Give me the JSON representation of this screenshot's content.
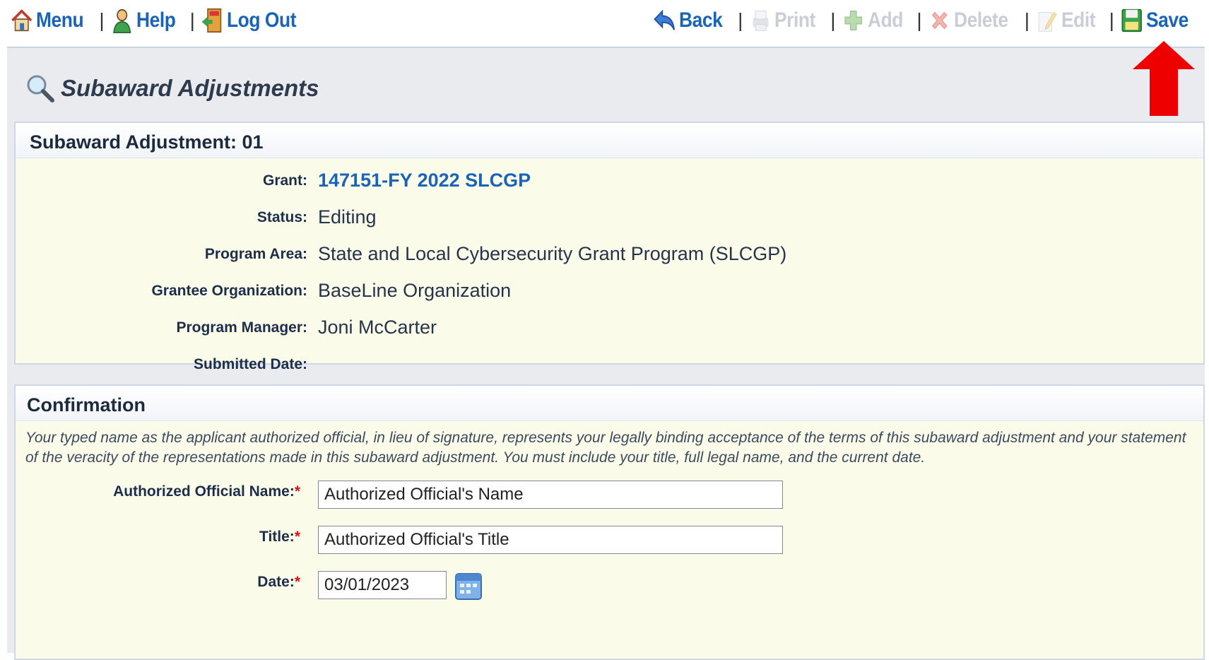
{
  "toolbar": {
    "left": [
      {
        "label": "Menu",
        "icon": "home-icon"
      },
      {
        "label": "Help",
        "icon": "help-person-icon"
      },
      {
        "label": "Log Out",
        "icon": "exit-door-icon"
      }
    ],
    "right": [
      {
        "label": "Back",
        "icon": "back-arrow-icon",
        "enabled": true
      },
      {
        "label": "Print",
        "icon": "printer-icon",
        "enabled": false
      },
      {
        "label": "Add",
        "icon": "add-icon",
        "enabled": false
      },
      {
        "label": "Delete",
        "icon": "delete-icon",
        "enabled": false
      },
      {
        "label": "Edit",
        "icon": "edit-icon",
        "enabled": false
      },
      {
        "label": "Save",
        "icon": "save-disk-icon",
        "enabled": true
      }
    ],
    "separator": "|"
  },
  "page": {
    "title": "Subaward Adjustments"
  },
  "details": {
    "header": "Subaward Adjustment: 01",
    "grant_label": "Grant:",
    "grant_value": "147151-FY 2022 SLCGP",
    "status_label": "Status:",
    "status_value": "Editing",
    "program_area_label": "Program Area:",
    "program_area_value": "State and Local Cybersecurity Grant Program (SLCGP)",
    "grantee_label": "Grantee Organization:",
    "grantee_value": "BaseLine Organization",
    "manager_label": "Program Manager:",
    "manager_value": "Joni McCarter",
    "submitted_label": "Submitted Date:",
    "submitted_value": ""
  },
  "confirmation": {
    "header": "Confirmation",
    "note": "Your typed name as the applicant authorized official, in lieu of signature, represents your legally binding acceptance of the terms of this subaward adjustment and your statement of the veracity of the representations made in this subaward adjustment. You must include your title, full legal name, and the current date.",
    "name_label": "Authorized Official Name:",
    "name_value": "Authorized Official's Name",
    "title_label": "Title:",
    "title_value": "Authorized Official's Title",
    "date_label": "Date:",
    "date_value": "03/01/2023",
    "required_mark": "*"
  },
  "colors": {
    "link": "#1a64b8",
    "disabled": "#c9ced6",
    "panel_bg": "#fbfbe9",
    "annotation_arrow": "#ee0000"
  }
}
